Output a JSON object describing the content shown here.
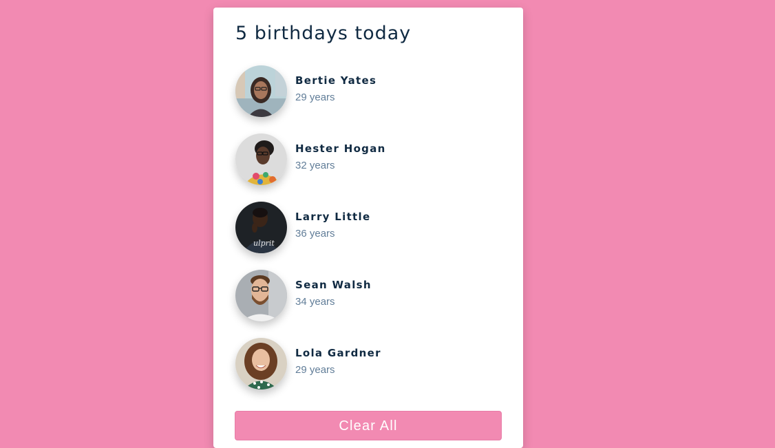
{
  "header": {
    "title": "5 birthdays today"
  },
  "people": [
    {
      "name": "Bertie Yates",
      "age": "29 years",
      "avatar": "woman-glasses-street-photo"
    },
    {
      "name": "Hester Hogan",
      "age": "32 years",
      "avatar": "woman-colorful-dress-photo"
    },
    {
      "name": "Larry Little",
      "age": "36 years",
      "avatar": "man-dark-background-photo"
    },
    {
      "name": "Sean Walsh",
      "age": "34 years",
      "avatar": "man-glasses-beard-photo"
    },
    {
      "name": "Lola Gardner",
      "age": "29 years",
      "avatar": "woman-curly-hair-photo"
    }
  ],
  "actions": {
    "clear_label": "Clear All"
  },
  "colors": {
    "background": "#f28ab2",
    "button": "#f28ab2",
    "heading": "#102a42",
    "subtext": "#617d98"
  }
}
